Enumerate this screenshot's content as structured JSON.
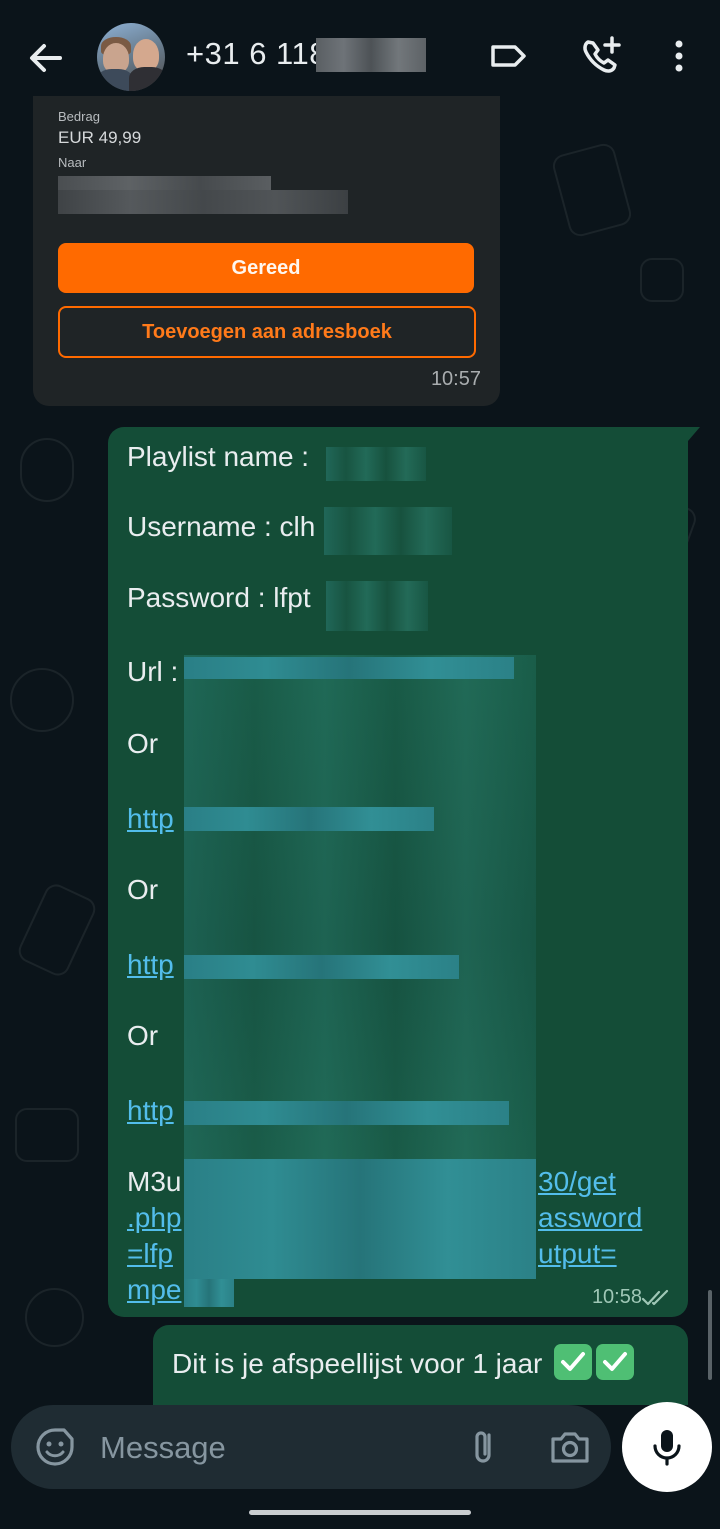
{
  "header": {
    "contact_name": "+31 6 118",
    "back_icon": "arrow-back-icon",
    "label_icon": "label-icon",
    "call_icon": "add-call-icon",
    "menu_icon": "more-vert-icon"
  },
  "payment_card": {
    "amount_label": "Bedrag",
    "amount_value": "EUR 49,99",
    "to_label": "Naar",
    "done_button": "Gereed",
    "address_button": "Toevoegen aan adresboek",
    "time": "10:57"
  },
  "message_out": {
    "playlist_line": "Playlist name :",
    "username_line": "Username : clh",
    "password_line": "Password : lfpt",
    "url_line": "Url :",
    "or_1": "Or",
    "link_1": "http",
    "or_2": "Or",
    "link_2": "http",
    "or_3": "Or",
    "link_3": "http",
    "m3u_prefix": "M3u",
    "m3u_line2_link_start": ".php",
    "m3u_line3_link_start": "=lfp",
    "m3u_line4_link_start": "mpe",
    "m3u_line1_link_end": "30/get",
    "m3u_line2_link_end": "assword",
    "m3u_line3_link_end": "utput=",
    "time": "10:58",
    "status_icon": "double-check-icon"
  },
  "message_out_2": {
    "text": "Dit is je afspeellijst voor 1 jaar",
    "emoji_icon": "check-mark-button-icon"
  },
  "composer": {
    "placeholder": "Message",
    "emoji_icon": "sticker-icon",
    "attach_icon": "paperclip-icon",
    "camera_icon": "camera-icon",
    "mic_icon": "mic-icon"
  },
  "colors": {
    "background": "#0b141a",
    "outgoing_bubble": "#144d37",
    "incoming_bubble": "#1f2426",
    "accent_orange": "#ff6a00",
    "link": "#53bdeb"
  }
}
